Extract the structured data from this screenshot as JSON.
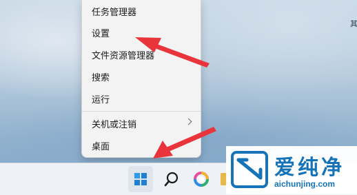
{
  "context_menu": {
    "items": [
      {
        "label": "任务管理器"
      },
      {
        "label": "设置"
      },
      {
        "label": "文件资源管理器"
      },
      {
        "label": "搜索"
      },
      {
        "label": "运行"
      },
      {
        "label": "关机或注销",
        "has_submenu": true
      },
      {
        "label": "桌面"
      }
    ]
  },
  "taskbar": {
    "icons": [
      "windows-start-icon",
      "search-icon",
      "copilot-icon",
      "file-explorer-icon"
    ]
  },
  "desktop": {
    "edge_text": "其"
  },
  "watermark": {
    "name": "爱纯净",
    "url": "aichunjing.com"
  },
  "colors": {
    "annotation_arrow": "#e8343a",
    "accent": "#1e7fd4",
    "watermark": "#1673b8"
  }
}
